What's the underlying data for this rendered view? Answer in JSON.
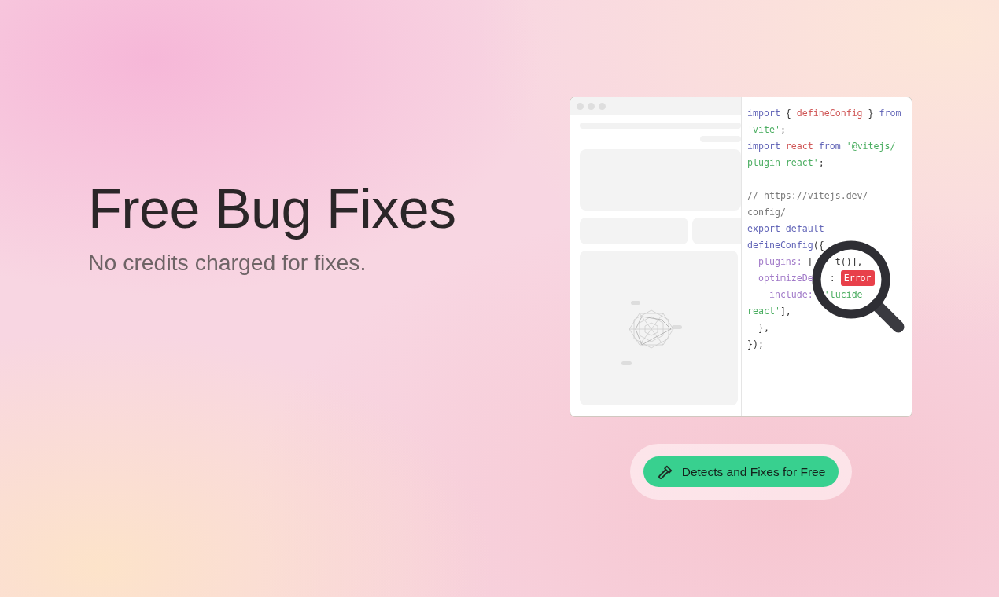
{
  "hero": {
    "title": "Free Bug Fixes",
    "subtitle": "No credits charged for fixes."
  },
  "code_lines": [
    {
      "tokens": [
        {
          "kind": "keyword",
          "text": "import"
        },
        {
          "kind": "plain",
          "text": " { "
        },
        {
          "kind": "name",
          "text": "defineConfig"
        },
        {
          "kind": "plain",
          "text": " } "
        },
        {
          "kind": "keyword",
          "text": "from"
        }
      ]
    },
    {
      "tokens": [
        {
          "kind": "string",
          "text": "'vite'"
        },
        {
          "kind": "plain",
          "text": ";"
        }
      ]
    },
    {
      "tokens": [
        {
          "kind": "keyword",
          "text": "import"
        },
        {
          "kind": "name",
          "text": " react"
        },
        {
          "kind": "keyword",
          "text": " from"
        },
        {
          "kind": "string",
          "text": " '@vitejs/"
        }
      ]
    },
    {
      "tokens": [
        {
          "kind": "string",
          "text": "plugin-react'"
        },
        {
          "kind": "plain",
          "text": ";"
        }
      ]
    },
    {
      "blank_before": true,
      "tokens": [
        {
          "kind": "comment",
          "text": "// https://vitejs.dev/"
        }
      ]
    },
    {
      "tokens": [
        {
          "kind": "comment",
          "text": "config/"
        }
      ]
    },
    {
      "tokens": [
        {
          "kind": "keyword",
          "text": "export default"
        }
      ]
    },
    {
      "tokens": [
        {
          "kind": "keyword",
          "text": "defineConfig"
        },
        {
          "kind": "plain",
          "text": "({"
        }
      ]
    },
    {
      "tokens": [
        {
          "kind": "property",
          "text": "  plugins:"
        },
        {
          "kind": "plain",
          "text": " ["
        },
        {
          "kind": "plain",
          "text": "    t()],"
        }
      ]
    },
    {
      "tokens": [
        {
          "kind": "property",
          "text": "  optimizeDe"
        },
        {
          "kind": "plain",
          "text": "   : "
        },
        {
          "kind": "error",
          "text": "Error"
        }
      ]
    },
    {
      "tokens": [
        {
          "kind": "property",
          "text": "    include:"
        },
        {
          "kind": "string",
          "text": "  'lucide-"
        }
      ]
    },
    {
      "tokens": [
        {
          "kind": "string",
          "text": "react'"
        },
        {
          "kind": "plain",
          "text": "],"
        }
      ]
    },
    {
      "tokens": [
        {
          "kind": "plain",
          "text": "  },"
        }
      ]
    },
    {
      "tokens": [
        {
          "kind": "plain",
          "text": "});"
        }
      ]
    }
  ],
  "cta_button": {
    "label": "Detects and Fixes for Free"
  }
}
